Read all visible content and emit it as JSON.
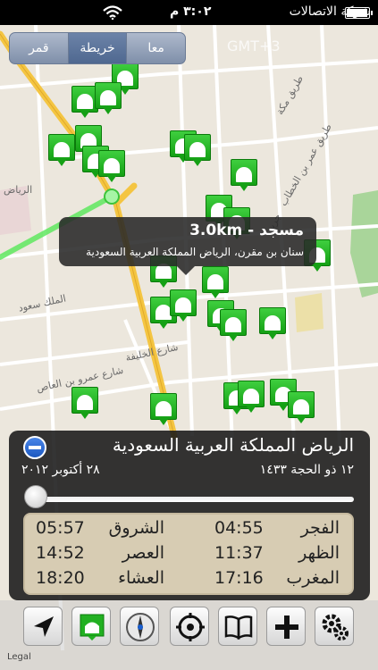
{
  "status_bar": {
    "carrier": "شركة الاتصالات",
    "time": "٣:٠٢ م"
  },
  "segmented": {
    "items": [
      {
        "label": "معا"
      },
      {
        "label": "خريطة",
        "active": true
      },
      {
        "label": "قمر"
      }
    ]
  },
  "map": {
    "timezone_label": "GMT+3",
    "road_labels": [
      "طريق مكة",
      "طريق عمر بن الخطاب",
      "جرير",
      "شارع عمرو بن العاص",
      "شارع الخليفة",
      "الرياض",
      "الملك سعود"
    ]
  },
  "callout": {
    "title": "مسجد - 3.0km",
    "subtitle": "سنان بن مقرن، الرياض المملكة العربية السعودية"
  },
  "panel": {
    "city": "الرياض المملكة العربية السعودية",
    "hijri_date": "١٢ ذو الحجة ١٤٣٣",
    "gregorian_date": "٢٨ أكتوبر ٢٠١٢",
    "slider_value": 0.0,
    "prayers": [
      {
        "name": "الفجر",
        "time": "04:55"
      },
      {
        "name": "الشروق",
        "time": "05:57"
      },
      {
        "name": "الظهر",
        "time": "11:37"
      },
      {
        "name": "العصر",
        "time": "14:52"
      },
      {
        "name": "المغرب",
        "time": "17:16"
      },
      {
        "name": "العشاء",
        "time": "18:20"
      }
    ]
  },
  "toolbar": {
    "buttons": [
      "location-arrow-icon",
      "mosque-icon",
      "compass-icon",
      "target-icon",
      "book-icon",
      "plus-icon",
      "settings-gear-icon"
    ]
  },
  "watermark": "Legal"
}
